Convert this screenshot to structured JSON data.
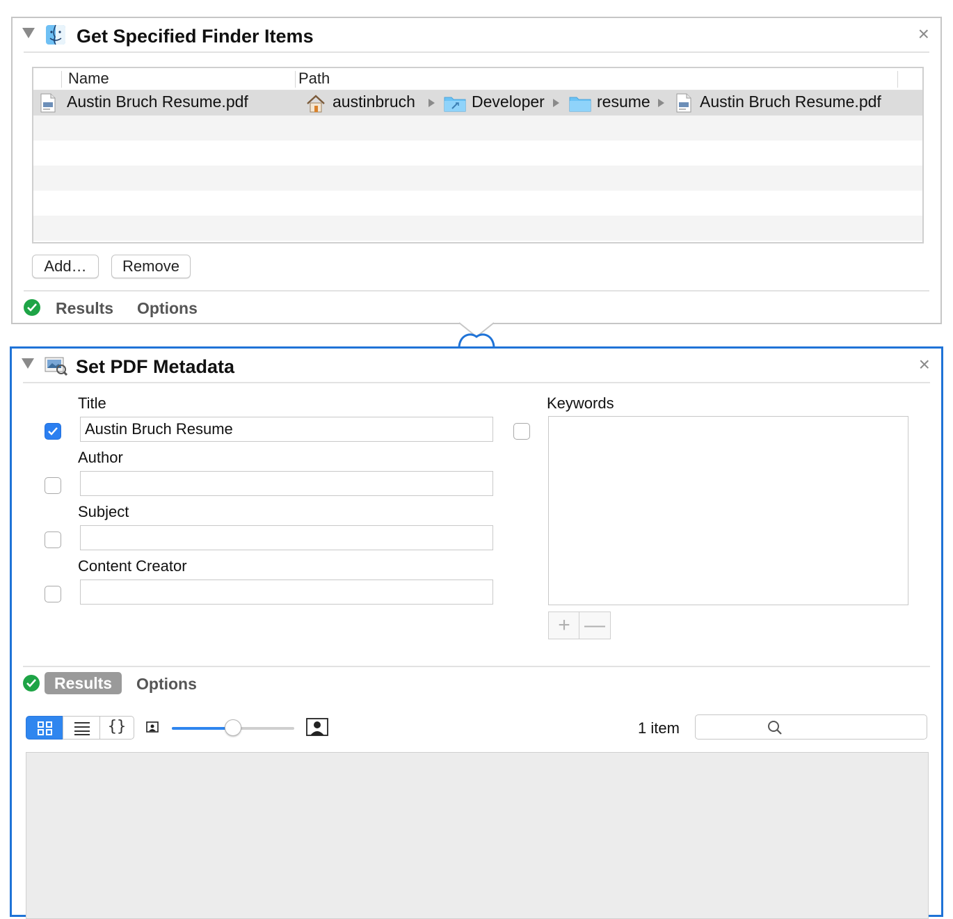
{
  "action1": {
    "title": "Get Specified Finder Items",
    "close_glyph": "×",
    "icon": "finder-icon",
    "table": {
      "columns": [
        "Name",
        "Path"
      ],
      "rows": [
        {
          "name": "Austin Bruch Resume.pdf",
          "path": [
            {
              "label": "austinbruch",
              "icon": "home-icon"
            },
            {
              "label": "Developer",
              "icon": "developer-folder-icon"
            },
            {
              "label": "resume",
              "icon": "folder-icon"
            },
            {
              "label": "Austin Bruch Resume.pdf",
              "icon": "pdf-file-icon"
            }
          ]
        }
      ]
    },
    "buttons": {
      "add": "Add…",
      "remove": "Remove"
    },
    "footer": {
      "results": "Results",
      "options": "Options"
    }
  },
  "action2": {
    "title": "Set PDF Metadata",
    "close_glyph": "×",
    "icon": "preview-pdf-icon",
    "fields": {
      "title": {
        "label": "Title",
        "value": "Austin Bruch Resume",
        "checked": true
      },
      "author": {
        "label": "Author",
        "value": "",
        "checked": false
      },
      "subject": {
        "label": "Subject",
        "value": "",
        "checked": false
      },
      "content_creator": {
        "label": "Content Creator",
        "value": "",
        "checked": false
      },
      "keywords": {
        "label": "Keywords",
        "checked": false
      }
    },
    "keyword_buttons": {
      "add": "+",
      "remove": "—"
    },
    "footer": {
      "results": "Results",
      "options": "Options"
    },
    "results_view": {
      "views": [
        "grid-view-icon",
        "list-view-icon",
        "json-view-icon"
      ],
      "active_view": "grid-view-icon",
      "icon_size_level": 0.5,
      "item_count": "1 item",
      "brackets_glyph": "{}"
    }
  },
  "colors": {
    "accent": "#2f86ef",
    "selected_border": "#1f73d7",
    "success": "#1ea446",
    "row_selected": "#dcdcdc"
  }
}
